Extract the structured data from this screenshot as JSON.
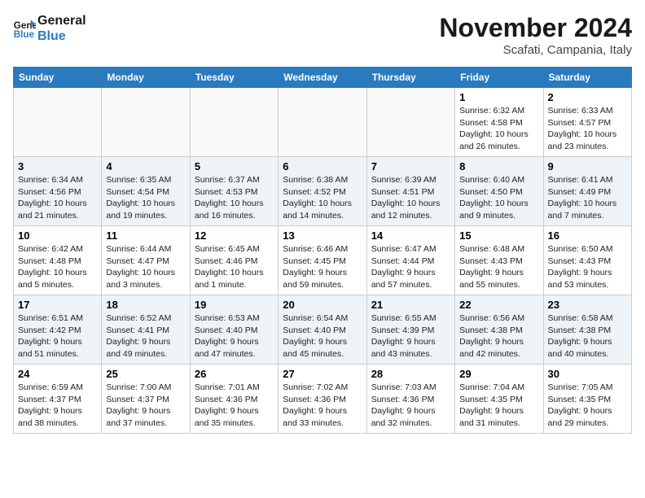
{
  "header": {
    "logo_line1": "General",
    "logo_line2": "Blue",
    "month_title": "November 2024",
    "location": "Scafati, Campania, Italy"
  },
  "weekdays": [
    "Sunday",
    "Monday",
    "Tuesday",
    "Wednesday",
    "Thursday",
    "Friday",
    "Saturday"
  ],
  "weeks": [
    [
      {
        "day": "",
        "info": ""
      },
      {
        "day": "",
        "info": ""
      },
      {
        "day": "",
        "info": ""
      },
      {
        "day": "",
        "info": ""
      },
      {
        "day": "",
        "info": ""
      },
      {
        "day": "1",
        "info": "Sunrise: 6:32 AM\nSunset: 4:58 PM\nDaylight: 10 hours\nand 26 minutes."
      },
      {
        "day": "2",
        "info": "Sunrise: 6:33 AM\nSunset: 4:57 PM\nDaylight: 10 hours\nand 23 minutes."
      }
    ],
    [
      {
        "day": "3",
        "info": "Sunrise: 6:34 AM\nSunset: 4:56 PM\nDaylight: 10 hours\nand 21 minutes."
      },
      {
        "day": "4",
        "info": "Sunrise: 6:35 AM\nSunset: 4:54 PM\nDaylight: 10 hours\nand 19 minutes."
      },
      {
        "day": "5",
        "info": "Sunrise: 6:37 AM\nSunset: 4:53 PM\nDaylight: 10 hours\nand 16 minutes."
      },
      {
        "day": "6",
        "info": "Sunrise: 6:38 AM\nSunset: 4:52 PM\nDaylight: 10 hours\nand 14 minutes."
      },
      {
        "day": "7",
        "info": "Sunrise: 6:39 AM\nSunset: 4:51 PM\nDaylight: 10 hours\nand 12 minutes."
      },
      {
        "day": "8",
        "info": "Sunrise: 6:40 AM\nSunset: 4:50 PM\nDaylight: 10 hours\nand 9 minutes."
      },
      {
        "day": "9",
        "info": "Sunrise: 6:41 AM\nSunset: 4:49 PM\nDaylight: 10 hours\nand 7 minutes."
      }
    ],
    [
      {
        "day": "10",
        "info": "Sunrise: 6:42 AM\nSunset: 4:48 PM\nDaylight: 10 hours\nand 5 minutes."
      },
      {
        "day": "11",
        "info": "Sunrise: 6:44 AM\nSunset: 4:47 PM\nDaylight: 10 hours\nand 3 minutes."
      },
      {
        "day": "12",
        "info": "Sunrise: 6:45 AM\nSunset: 4:46 PM\nDaylight: 10 hours\nand 1 minute."
      },
      {
        "day": "13",
        "info": "Sunrise: 6:46 AM\nSunset: 4:45 PM\nDaylight: 9 hours\nand 59 minutes."
      },
      {
        "day": "14",
        "info": "Sunrise: 6:47 AM\nSunset: 4:44 PM\nDaylight: 9 hours\nand 57 minutes."
      },
      {
        "day": "15",
        "info": "Sunrise: 6:48 AM\nSunset: 4:43 PM\nDaylight: 9 hours\nand 55 minutes."
      },
      {
        "day": "16",
        "info": "Sunrise: 6:50 AM\nSunset: 4:43 PM\nDaylight: 9 hours\nand 53 minutes."
      }
    ],
    [
      {
        "day": "17",
        "info": "Sunrise: 6:51 AM\nSunset: 4:42 PM\nDaylight: 9 hours\nand 51 minutes."
      },
      {
        "day": "18",
        "info": "Sunrise: 6:52 AM\nSunset: 4:41 PM\nDaylight: 9 hours\nand 49 minutes."
      },
      {
        "day": "19",
        "info": "Sunrise: 6:53 AM\nSunset: 4:40 PM\nDaylight: 9 hours\nand 47 minutes."
      },
      {
        "day": "20",
        "info": "Sunrise: 6:54 AM\nSunset: 4:40 PM\nDaylight: 9 hours\nand 45 minutes."
      },
      {
        "day": "21",
        "info": "Sunrise: 6:55 AM\nSunset: 4:39 PM\nDaylight: 9 hours\nand 43 minutes."
      },
      {
        "day": "22",
        "info": "Sunrise: 6:56 AM\nSunset: 4:38 PM\nDaylight: 9 hours\nand 42 minutes."
      },
      {
        "day": "23",
        "info": "Sunrise: 6:58 AM\nSunset: 4:38 PM\nDaylight: 9 hours\nand 40 minutes."
      }
    ],
    [
      {
        "day": "24",
        "info": "Sunrise: 6:59 AM\nSunset: 4:37 PM\nDaylight: 9 hours\nand 38 minutes."
      },
      {
        "day": "25",
        "info": "Sunrise: 7:00 AM\nSunset: 4:37 PM\nDaylight: 9 hours\nand 37 minutes."
      },
      {
        "day": "26",
        "info": "Sunrise: 7:01 AM\nSunset: 4:36 PM\nDaylight: 9 hours\nand 35 minutes."
      },
      {
        "day": "27",
        "info": "Sunrise: 7:02 AM\nSunset: 4:36 PM\nDaylight: 9 hours\nand 33 minutes."
      },
      {
        "day": "28",
        "info": "Sunrise: 7:03 AM\nSunset: 4:36 PM\nDaylight: 9 hours\nand 32 minutes."
      },
      {
        "day": "29",
        "info": "Sunrise: 7:04 AM\nSunset: 4:35 PM\nDaylight: 9 hours\nand 31 minutes."
      },
      {
        "day": "30",
        "info": "Sunrise: 7:05 AM\nSunset: 4:35 PM\nDaylight: 9 hours\nand 29 minutes."
      }
    ]
  ]
}
